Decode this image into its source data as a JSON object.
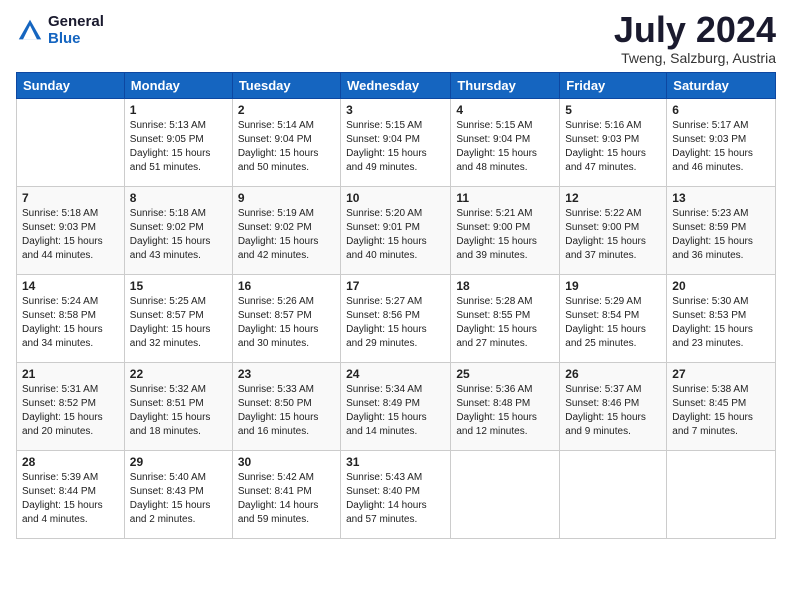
{
  "header": {
    "logo_general": "General",
    "logo_blue": "Blue",
    "month_year": "July 2024",
    "location": "Tweng, Salzburg, Austria"
  },
  "days_of_week": [
    "Sunday",
    "Monday",
    "Tuesday",
    "Wednesday",
    "Thursday",
    "Friday",
    "Saturday"
  ],
  "weeks": [
    [
      {
        "day": "",
        "text": ""
      },
      {
        "day": "1",
        "text": "Sunrise: 5:13 AM\nSunset: 9:05 PM\nDaylight: 15 hours\nand 51 minutes."
      },
      {
        "day": "2",
        "text": "Sunrise: 5:14 AM\nSunset: 9:04 PM\nDaylight: 15 hours\nand 50 minutes."
      },
      {
        "day": "3",
        "text": "Sunrise: 5:15 AM\nSunset: 9:04 PM\nDaylight: 15 hours\nand 49 minutes."
      },
      {
        "day": "4",
        "text": "Sunrise: 5:15 AM\nSunset: 9:04 PM\nDaylight: 15 hours\nand 48 minutes."
      },
      {
        "day": "5",
        "text": "Sunrise: 5:16 AM\nSunset: 9:03 PM\nDaylight: 15 hours\nand 47 minutes."
      },
      {
        "day": "6",
        "text": "Sunrise: 5:17 AM\nSunset: 9:03 PM\nDaylight: 15 hours\nand 46 minutes."
      }
    ],
    [
      {
        "day": "7",
        "text": "Sunrise: 5:18 AM\nSunset: 9:03 PM\nDaylight: 15 hours\nand 44 minutes."
      },
      {
        "day": "8",
        "text": "Sunrise: 5:18 AM\nSunset: 9:02 PM\nDaylight: 15 hours\nand 43 minutes."
      },
      {
        "day": "9",
        "text": "Sunrise: 5:19 AM\nSunset: 9:02 PM\nDaylight: 15 hours\nand 42 minutes."
      },
      {
        "day": "10",
        "text": "Sunrise: 5:20 AM\nSunset: 9:01 PM\nDaylight: 15 hours\nand 40 minutes."
      },
      {
        "day": "11",
        "text": "Sunrise: 5:21 AM\nSunset: 9:00 PM\nDaylight: 15 hours\nand 39 minutes."
      },
      {
        "day": "12",
        "text": "Sunrise: 5:22 AM\nSunset: 9:00 PM\nDaylight: 15 hours\nand 37 minutes."
      },
      {
        "day": "13",
        "text": "Sunrise: 5:23 AM\nSunset: 8:59 PM\nDaylight: 15 hours\nand 36 minutes."
      }
    ],
    [
      {
        "day": "14",
        "text": "Sunrise: 5:24 AM\nSunset: 8:58 PM\nDaylight: 15 hours\nand 34 minutes."
      },
      {
        "day": "15",
        "text": "Sunrise: 5:25 AM\nSunset: 8:57 PM\nDaylight: 15 hours\nand 32 minutes."
      },
      {
        "day": "16",
        "text": "Sunrise: 5:26 AM\nSunset: 8:57 PM\nDaylight: 15 hours\nand 30 minutes."
      },
      {
        "day": "17",
        "text": "Sunrise: 5:27 AM\nSunset: 8:56 PM\nDaylight: 15 hours\nand 29 minutes."
      },
      {
        "day": "18",
        "text": "Sunrise: 5:28 AM\nSunset: 8:55 PM\nDaylight: 15 hours\nand 27 minutes."
      },
      {
        "day": "19",
        "text": "Sunrise: 5:29 AM\nSunset: 8:54 PM\nDaylight: 15 hours\nand 25 minutes."
      },
      {
        "day": "20",
        "text": "Sunrise: 5:30 AM\nSunset: 8:53 PM\nDaylight: 15 hours\nand 23 minutes."
      }
    ],
    [
      {
        "day": "21",
        "text": "Sunrise: 5:31 AM\nSunset: 8:52 PM\nDaylight: 15 hours\nand 20 minutes."
      },
      {
        "day": "22",
        "text": "Sunrise: 5:32 AM\nSunset: 8:51 PM\nDaylight: 15 hours\nand 18 minutes."
      },
      {
        "day": "23",
        "text": "Sunrise: 5:33 AM\nSunset: 8:50 PM\nDaylight: 15 hours\nand 16 minutes."
      },
      {
        "day": "24",
        "text": "Sunrise: 5:34 AM\nSunset: 8:49 PM\nDaylight: 15 hours\nand 14 minutes."
      },
      {
        "day": "25",
        "text": "Sunrise: 5:36 AM\nSunset: 8:48 PM\nDaylight: 15 hours\nand 12 minutes."
      },
      {
        "day": "26",
        "text": "Sunrise: 5:37 AM\nSunset: 8:46 PM\nDaylight: 15 hours\nand 9 minutes."
      },
      {
        "day": "27",
        "text": "Sunrise: 5:38 AM\nSunset: 8:45 PM\nDaylight: 15 hours\nand 7 minutes."
      }
    ],
    [
      {
        "day": "28",
        "text": "Sunrise: 5:39 AM\nSunset: 8:44 PM\nDaylight: 15 hours\nand 4 minutes."
      },
      {
        "day": "29",
        "text": "Sunrise: 5:40 AM\nSunset: 8:43 PM\nDaylight: 15 hours\nand 2 minutes."
      },
      {
        "day": "30",
        "text": "Sunrise: 5:42 AM\nSunset: 8:41 PM\nDaylight: 14 hours\nand 59 minutes."
      },
      {
        "day": "31",
        "text": "Sunrise: 5:43 AM\nSunset: 8:40 PM\nDaylight: 14 hours\nand 57 minutes."
      },
      {
        "day": "",
        "text": ""
      },
      {
        "day": "",
        "text": ""
      },
      {
        "day": "",
        "text": ""
      }
    ]
  ]
}
